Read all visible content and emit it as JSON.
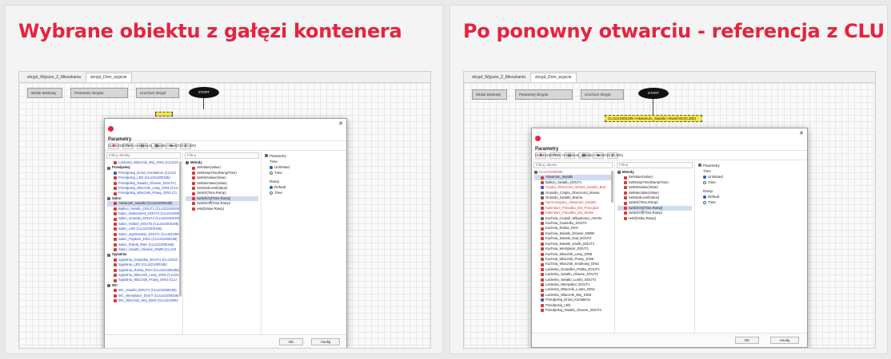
{
  "left": {
    "title": "Wybrane obiektu z gałęzi kontenera",
    "tabs": [
      "skrypt_Wyjscie_Z_Mieszkania",
      "skrypt_Dom_wyjscie"
    ],
    "blocks": [
      "Widok tekstowy",
      "Parametry skryptu",
      "Uruchom Skrypt",
      "START"
    ],
    "dialog": {
      "title": "Parametry",
      "subtitle": "CLU221000105->Akwarium_Swiatlo->SwitchOn(0,300)",
      "filter_objects": "Filtruj obiekty",
      "filter_methods": "Filtruj",
      "tree": [
        {
          "text": "Lazienka_Wlacznik_Wej_DIN1 (CLU221",
          "style": "blue",
          "ico": "r",
          "ind": true
        },
        {
          "text": "Przedpokoj",
          "style": "grp",
          "ico": "g"
        },
        {
          "text": "Przedpokoj_Drzwi_Kontaktron (CLU22",
          "style": "blue",
          "ico": "b",
          "ind": true
        },
        {
          "text": "Przedpokoj_LED (CLU221000195)",
          "style": "blue",
          "ico": "r",
          "ind": true
        },
        {
          "text": "Przedpokoj_Swiatlo_Glowne_DOUT4 (",
          "style": "blue",
          "ico": "r",
          "ind": true
        },
        {
          "text": "Przedpokoj_Wlacznik_Lewy_DIN1 (CLU",
          "style": "blue",
          "ico": "r",
          "ind": true
        },
        {
          "text": "Przedpokoj_Wlacznik_Prawy_DIN2 (CL",
          "style": "blue",
          "ico": "r",
          "ind": true
        },
        {
          "text": "Salon",
          "style": "grp",
          "ico": "g"
        },
        {
          "text": "Akwarium_Swiatlo (CLU221000195)",
          "style": "sel",
          "ico": "r",
          "ind": true
        },
        {
          "text": "Balkon_Swiatlo_DOUT1 (CLU221000195",
          "style": "blue",
          "ico": "r",
          "ind": true
        },
        {
          "text": "Salon_Biokominek_DOUT3 (CLU221000",
          "style": "blue",
          "ico": "r",
          "ind": true
        },
        {
          "text": "Salon_Gniazdo_DOUT2 (CLU221000195)",
          "style": "blue",
          "ico": "r",
          "ind": true
        },
        {
          "text": "Salon_Kinkiet_DOUT5 (CLU221000195)",
          "style": "blue",
          "ico": "r",
          "ind": true
        },
        {
          "text": "Salon_LED (CLU221000195)",
          "style": "blue",
          "ico": "r",
          "ind": true
        },
        {
          "text": "Salon_Ogrzewanie_DOUT1 (CLU221000",
          "style": "blue",
          "ico": "r",
          "ind": true
        },
        {
          "text": "Salon_Pnjaktor_DIN1 (CLU221000195)",
          "style": "blue",
          "ico": "r",
          "ind": true
        },
        {
          "text": "Salon_Roleta_RSH (CLU221000195)",
          "style": "blue",
          "ico": "r",
          "ind": true
        },
        {
          "text": "Salon_Swiatlo_Glowne_DIMM (CLU22",
          "style": "blue",
          "ico": "r",
          "ind": true
        },
        {
          "text": "Sypialnia",
          "style": "grp",
          "ico": "g"
        },
        {
          "text": "Sypialnia_Gniazdka_DOUT2 (CLU2210",
          "style": "blue",
          "ico": "r",
          "ind": true
        },
        {
          "text": "Sypialnia_LED (CLU221000195)",
          "style": "blue",
          "ico": "r",
          "ind": true
        },
        {
          "text": "Sypialnia_Roleta_RSH (CLU221000195)",
          "style": "blue",
          "ico": "r",
          "ind": true
        },
        {
          "text": "Sypialnia_Wlacznik_Lewy_DIN1 (CLU22",
          "style": "blue",
          "ico": "r",
          "ind": true
        },
        {
          "text": "Sypialnia_Wlacznik_Prawy_DIN4 (CLU",
          "style": "blue",
          "ico": "r",
          "ind": true
        },
        {
          "text": "WC",
          "style": "grp",
          "ico": "g"
        },
        {
          "text": "WC_Swiatlo_DOUT4 (CLU221000195)",
          "style": "blue",
          "ico": "r",
          "ind": true
        },
        {
          "text": "WC_Wentylator_DOUT (CLU221000195",
          "style": "blue",
          "ico": "r",
          "ind": true
        },
        {
          "text": "WC_Wlacznik_Wej_DIN3 (CLU2210001",
          "style": "blue",
          "ico": "r",
          "ind": true
        }
      ],
      "methods_header": "Metody",
      "methods": [
        "SetValue(Value)",
        "SetRampTime(RampTime)",
        "SetMinValue(Value)",
        "SetMaxValue(Value)",
        "SetStartLevel(Value)",
        "Switch(Time,Ramp)",
        "SwitchOn(Time,Ramp)",
        "SwitchOff(Time,Ramp)",
        "Hold(Value,Ramp)"
      ],
      "selected_method": "SwitchOn(Time,Ramp)",
      "params": {
        "header": "Parametry",
        "time_label": "Time",
        "time_opt1": "Unlimited",
        "time_opt2": "Time",
        "ramp_label": "Ramp",
        "ramp_opt1": "Default",
        "ramp_opt2": "Time"
      },
      "ok": "OK",
      "cancel": "Anuluj"
    }
  },
  "right": {
    "title": "Po ponowny otwarciu - referencja z CLU",
    "tabs": [
      "skrypt_Wyjscie_Z_Mieszkania",
      "skrypt_Dom_wyjscie"
    ],
    "blocks": [
      "Widok tekstowy",
      "Parametry skryptu",
      "Uruchom Skrypt",
      "START"
    ],
    "selected_block": "CLU221000195->Akwarium_Swiatlo->SwitchOn(0,300)",
    "dialog": {
      "title": "Parametry",
      "subtitle": "CLU221000195->Akwarium_Swiatlo->SwitchOn(0,300)",
      "filter_objects": "Filtruj obiekty",
      "filter_methods": "Filtruj",
      "tree": [
        {
          "text": "CLU221000195",
          "style": "redt",
          "ico": "g"
        },
        {
          "text": "Akwarium_Swiatlo",
          "style": "sel",
          "ico": "r",
          "ind": true
        },
        {
          "text": "Balkon_Swiatlo_DOUT1",
          "style": "",
          "ico": "r",
          "ind": true
        },
        {
          "text": "Czujka_Obecnosci_Brama_Swiatlo_Brar",
          "style": "redt",
          "ico": "b",
          "ind": true
        },
        {
          "text": "Gniazdo_Czujka_Obecnosci_Brama",
          "style": "",
          "ico": "g",
          "ind": true
        },
        {
          "text": "Gniazdo_Swiatlo_Brama",
          "style": "",
          "ico": "g",
          "ind": true
        },
        {
          "text": "Harmonogram_Akwarium_Swiatlo",
          "style": "redt",
          "ico": "r",
          "ind": true
        },
        {
          "text": "Kalendarz_Pobudka_Dni_Pracujace",
          "style": "redt",
          "ico": "r",
          "ind": true
        },
        {
          "text": "Kalendarz_Pobudka_Dni_Wolne",
          "style": "redt",
          "ico": "r",
          "ind": true
        },
        {
          "text": "Kuchnia_Czujnik_Wilgotnosci_ANAIN",
          "style": "",
          "ico": "g",
          "ind": true
        },
        {
          "text": "Kuchnia_Gniazdko_DOUT4",
          "style": "",
          "ico": "r",
          "ind": true
        },
        {
          "text": "Kuchnia_Roleta_RSH",
          "style": "",
          "ico": "r",
          "ind": true
        },
        {
          "text": "Kuchnia_Swiatlo_Glowne_DIMM",
          "style": "",
          "ico": "r",
          "ind": true
        },
        {
          "text": "Kuchnia_Swiatlo_Nad_DOUT2",
          "style": "",
          "ico": "r",
          "ind": true
        },
        {
          "text": "Kuchnia_Swiatlo_Szafki_DOUT1",
          "style": "",
          "ico": "r",
          "ind": true
        },
        {
          "text": "Kuchnia_Wentylator_DOUT1",
          "style": "",
          "ico": "r",
          "ind": true
        },
        {
          "text": "Kuchnia_Wlacznik_Lewy_DIN5",
          "style": "",
          "ico": "r",
          "ind": true
        },
        {
          "text": "Kuchnia_Wlacznik_Prawy_DIN6",
          "style": "",
          "ico": "r",
          "ind": true
        },
        {
          "text": "Kuchnia_Wlacznik_Srodkowy_DIN2",
          "style": "",
          "ico": "r",
          "ind": true
        },
        {
          "text": "Lazienka_Gniazdko_Pralka_DOUT2",
          "style": "",
          "ico": "r",
          "ind": true
        },
        {
          "text": "Lazienka_Swiatlo_Glowne_DOUT3",
          "style": "",
          "ico": "r",
          "ind": true
        },
        {
          "text": "Lazienka_Swiatlo_Lustro_DOUT4",
          "style": "",
          "ico": "r",
          "ind": true
        },
        {
          "text": "Lazienka_Wentylator_DOUT1",
          "style": "",
          "ico": "r",
          "ind": true
        },
        {
          "text": "Lazienka_Wlacznik_Lustro_DIN4",
          "style": "",
          "ico": "r",
          "ind": true
        },
        {
          "text": "Lazienka_Wlacznik_Wej_DIN3",
          "style": "",
          "ico": "r",
          "ind": true
        },
        {
          "text": "Przedpokoj_Drzwi_Kontaktron",
          "style": "",
          "ico": "b",
          "ind": true
        },
        {
          "text": "Przedpokoj_LED",
          "style": "",
          "ico": "r",
          "ind": true
        },
        {
          "text": "Przedpokoj_Swiatlo_Glowne_DOUT4",
          "style": "",
          "ico": "r",
          "ind": true
        }
      ],
      "methods_header": "Metody",
      "methods": [
        "SetValue(Value)",
        "SetRampTime(RampTime)",
        "SetMinValue(Value)",
        "SetMaxValue(Value)",
        "SetStartLevel(Value)",
        "Switch(Time,Ramp)",
        "SwitchOn(Time,Ramp)",
        "SwitchOff(Time,Ramp)",
        "Hold(Value,Ramp)"
      ],
      "selected_method": "SwitchOn(Time,Ramp)",
      "params": {
        "header": "Parametry",
        "time_label": "Time",
        "time_opt1": "Unlimited",
        "time_opt2": "Time",
        "ramp_label": "Ramp",
        "ramp_opt1": "Default",
        "ramp_opt2": "Time"
      },
      "ok": "OK",
      "cancel": "Anuluj"
    }
  }
}
